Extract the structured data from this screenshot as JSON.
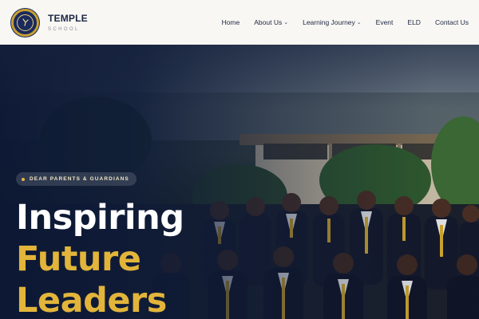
{
  "header": {
    "brand_name": "TEMPLE",
    "brand_sub": "SCHOOL",
    "nav": [
      {
        "label": "Home",
        "dropdown": false
      },
      {
        "label": "About Us",
        "dropdown": true
      },
      {
        "label": "Learning Journey",
        "dropdown": true
      },
      {
        "label": "Event",
        "dropdown": false
      },
      {
        "label": "ELD",
        "dropdown": false
      },
      {
        "label": "Contact Us",
        "dropdown": false
      }
    ]
  },
  "hero": {
    "badge": "DEAR PARENTS & GUARDIANS",
    "headline": {
      "line1": "Inspiring",
      "line2": "Future",
      "line3": "Leaders"
    },
    "background_image": "students-group-photo"
  },
  "colors": {
    "navy": "#1a2a5e",
    "gold": "#e2b53a",
    "header_bg": "#f8f7f3",
    "hero_overlay": "#0c1834"
  },
  "icons": {
    "logo": "school-crest-icon",
    "dropdown": "chevron-down-icon",
    "badge_dot": "dot-icon"
  }
}
